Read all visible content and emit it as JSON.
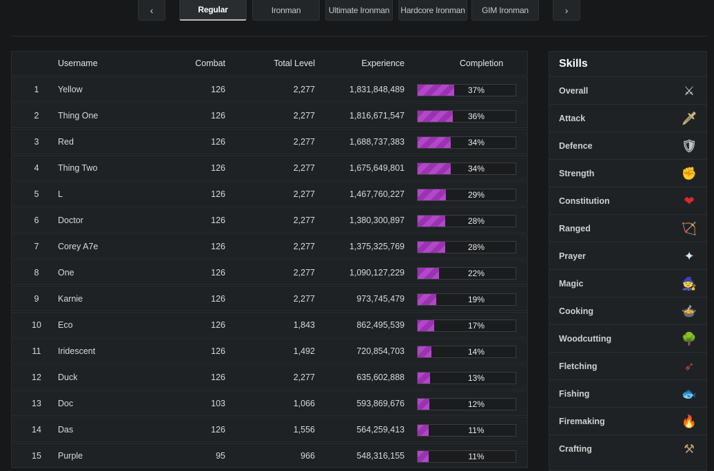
{
  "tabs": {
    "prev": "‹",
    "next": "›",
    "items": [
      {
        "label": "Regular",
        "active": true
      },
      {
        "label": "Ironman",
        "active": false
      },
      {
        "label": "Ultimate Ironman",
        "active": false
      },
      {
        "label": "Hardcore Ironman",
        "active": false
      },
      {
        "label": "GIM Ironman",
        "active": false
      }
    ]
  },
  "table": {
    "headers": {
      "username": "Username",
      "combat": "Combat",
      "total_level": "Total Level",
      "experience": "Experience",
      "completion": "Completion"
    },
    "rows": [
      {
        "rank": "1",
        "username": "Yellow",
        "combat": "126",
        "total": "2,277",
        "exp": "1,831,848,489",
        "completion": "37%",
        "pct": 37
      },
      {
        "rank": "2",
        "username": "Thing One",
        "combat": "126",
        "total": "2,277",
        "exp": "1,816,671,547",
        "completion": "36%",
        "pct": 36
      },
      {
        "rank": "3",
        "username": "Red",
        "combat": "126",
        "total": "2,277",
        "exp": "1,688,737,383",
        "completion": "34%",
        "pct": 34
      },
      {
        "rank": "4",
        "username": "Thing Two",
        "combat": "126",
        "total": "2,277",
        "exp": "1,675,649,801",
        "completion": "34%",
        "pct": 34
      },
      {
        "rank": "5",
        "username": "L",
        "combat": "126",
        "total": "2,277",
        "exp": "1,467,760,227",
        "completion": "29%",
        "pct": 29
      },
      {
        "rank": "6",
        "username": "Doctor",
        "combat": "126",
        "total": "2,277",
        "exp": "1,380,300,897",
        "completion": "28%",
        "pct": 28
      },
      {
        "rank": "7",
        "username": "Corey A7e",
        "combat": "126",
        "total": "2,277",
        "exp": "1,375,325,769",
        "completion": "28%",
        "pct": 28
      },
      {
        "rank": "8",
        "username": "One",
        "combat": "126",
        "total": "2,277",
        "exp": "1,090,127,229",
        "completion": "22%",
        "pct": 22
      },
      {
        "rank": "9",
        "username": "Karnie",
        "combat": "126",
        "total": "2,277",
        "exp": "973,745,479",
        "completion": "19%",
        "pct": 19
      },
      {
        "rank": "10",
        "username": "Eco",
        "combat": "126",
        "total": "1,843",
        "exp": "862,495,539",
        "completion": "17%",
        "pct": 17
      },
      {
        "rank": "11",
        "username": "Iridescent",
        "combat": "126",
        "total": "1,492",
        "exp": "720,854,703",
        "completion": "14%",
        "pct": 14
      },
      {
        "rank": "12",
        "username": "Duck",
        "combat": "126",
        "total": "2,277",
        "exp": "635,602,888",
        "completion": "13%",
        "pct": 13
      },
      {
        "rank": "13",
        "username": "Doc",
        "combat": "103",
        "total": "1,066",
        "exp": "593,869,676",
        "completion": "12%",
        "pct": 12
      },
      {
        "rank": "14",
        "username": "Das",
        "combat": "126",
        "total": "1,556",
        "exp": "564,259,413",
        "completion": "11%",
        "pct": 11
      },
      {
        "rank": "15",
        "username": "Purple",
        "combat": "95",
        "total": "966",
        "exp": "548,316,155",
        "completion": "11%",
        "pct": 11
      }
    ]
  },
  "skills": {
    "title": "Skills",
    "items": [
      {
        "label": "Overall",
        "icon": "crossed-swords-icon",
        "glyph": "⚔",
        "color": "#d8d8d8"
      },
      {
        "label": "Attack",
        "icon": "sword-icon",
        "glyph": "🗡",
        "color": "#c9b27a"
      },
      {
        "label": "Defence",
        "icon": "shield-icon",
        "glyph": "🛡",
        "color": "#bfc5c9"
      },
      {
        "label": "Strength",
        "icon": "fist-icon",
        "glyph": "✊",
        "color": "#d9976b"
      },
      {
        "label": "Constitution",
        "icon": "heart-icon",
        "glyph": "❤",
        "color": "#e0262b"
      },
      {
        "label": "Ranged",
        "icon": "bow-icon",
        "glyph": "🏹",
        "color": "#a87b47"
      },
      {
        "label": "Prayer",
        "icon": "star-icon",
        "glyph": "✦",
        "color": "#cfe6ff"
      },
      {
        "label": "Magic",
        "icon": "wizard-hat-icon",
        "glyph": "🧙",
        "color": "#4a5ac9"
      },
      {
        "label": "Cooking",
        "icon": "cauldron-icon",
        "glyph": "🍲",
        "color": "#d06a2a"
      },
      {
        "label": "Woodcutting",
        "icon": "tree-icon",
        "glyph": "🌳",
        "color": "#4f8a3a"
      },
      {
        "label": "Fletching",
        "icon": "arrow-icon",
        "glyph": "➶",
        "color": "#c0443f"
      },
      {
        "label": "Fishing",
        "icon": "fish-icon",
        "glyph": "🐟",
        "color": "#9fc0d8"
      },
      {
        "label": "Firemaking",
        "icon": "fire-icon",
        "glyph": "🔥",
        "color": "#e35d1e"
      },
      {
        "label": "Crafting",
        "icon": "hammer-chisel-icon",
        "glyph": "⚒",
        "color": "#b89a6a"
      }
    ]
  }
}
